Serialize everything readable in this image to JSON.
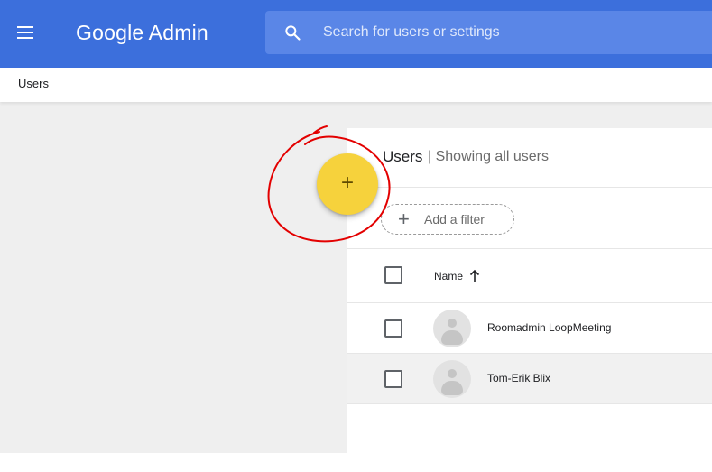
{
  "app": {
    "menu_icon": "hamburger-menu-icon",
    "brand": "Google Admin",
    "top_bar_color": "#3c6fdc",
    "accent_color": "#f6d23c"
  },
  "search": {
    "icon": "search-icon",
    "placeholder": "Search for users or settings"
  },
  "breadcrumb": {
    "label": "Users"
  },
  "card": {
    "title": "Users",
    "subtitle": "| Showing all users"
  },
  "filter": {
    "icon": "plus-icon",
    "label": "Add a filter"
  },
  "table": {
    "column_name": "Name",
    "sort_icon": "arrow-up-icon",
    "rows": [
      {
        "name": "Roomadmin LoopMeeting",
        "selected": false
      },
      {
        "name": "Tom-Erik Blix",
        "selected": false
      }
    ]
  },
  "fab": {
    "symbol": "+",
    "icon": "add-user-icon"
  }
}
